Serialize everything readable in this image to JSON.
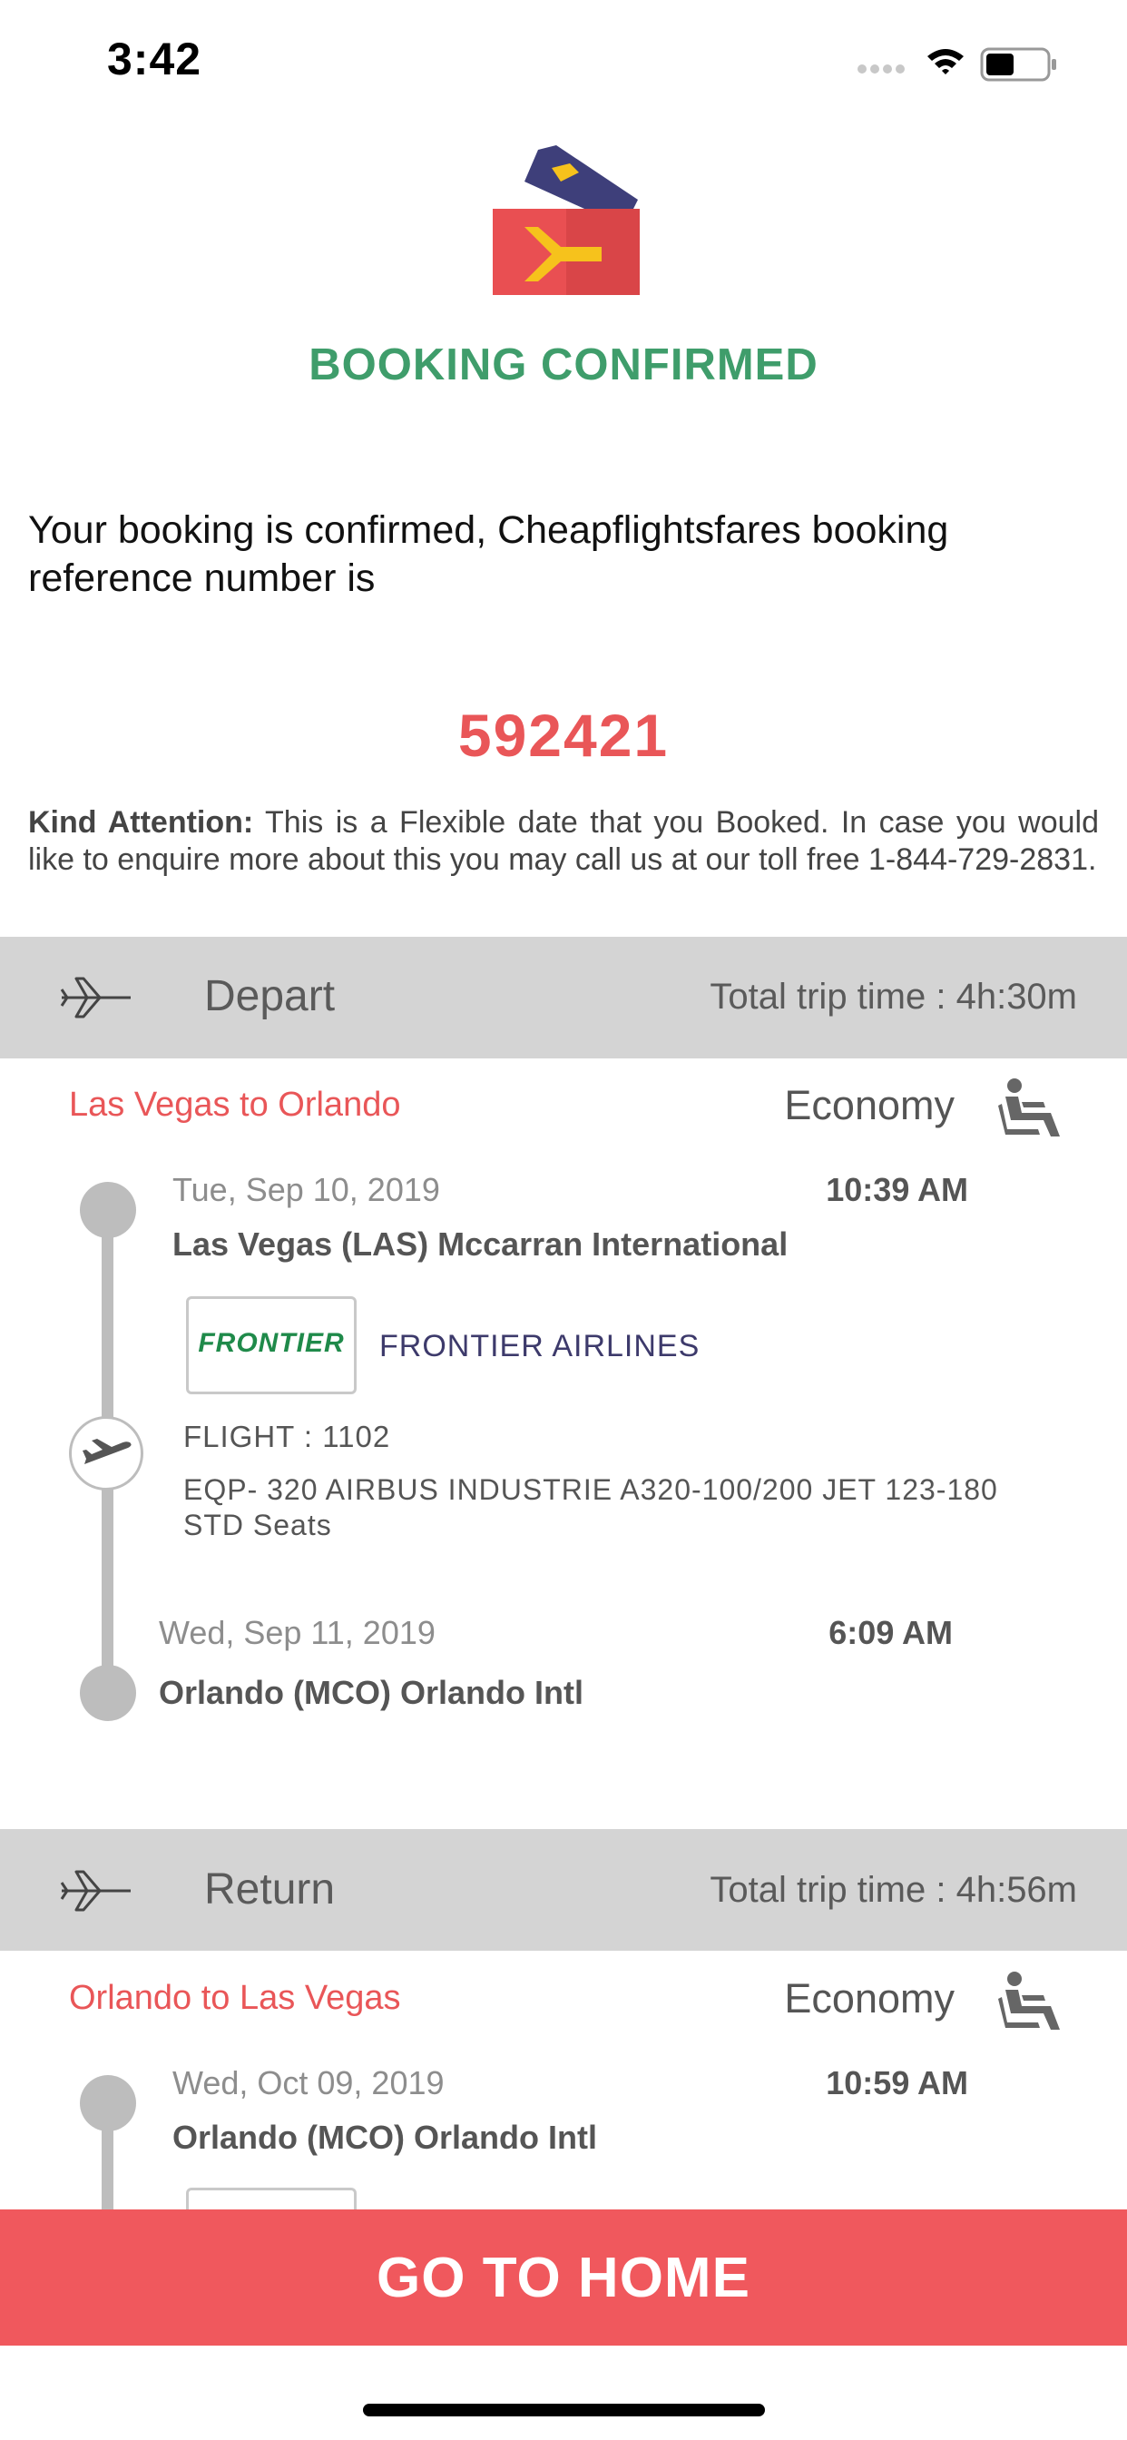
{
  "status_bar": {
    "time": "3:42"
  },
  "header": {
    "title": "BOOKING CONFIRMED",
    "intro": "Your booking is confirmed, Cheapflightsfares booking reference number is",
    "reference_number": "592421",
    "attention_label": "Kind Attention:",
    "attention_text": " This is a Flexible date that you Booked. In case you would like to enquire more about this you may call us at our toll free 1-844-729-2831."
  },
  "depart": {
    "section_title": "Depart",
    "total_trip_time": "Total trip time : 4h:30m",
    "route": "Las Vegas to Orlando",
    "cabin": "Economy",
    "origin_date": "Tue, Sep 10, 2019",
    "origin_time": "10:39 AM",
    "origin_airport": "Las Vegas (LAS) Mccarran International",
    "airline_logo_text": "FRONTIER",
    "airline_name": "FRONTIER AIRLINES",
    "flight": "FLIGHT : 1102",
    "equipment": "EQP- 320 AIRBUS INDUSTRIE A320-100/200 JET 123-180 STD Seats",
    "dest_date": "Wed, Sep 11, 2019",
    "dest_time": "6:09 AM",
    "dest_airport": "Orlando (MCO) Orlando Intl"
  },
  "return": {
    "section_title": "Return",
    "total_trip_time": "Total trip time : 4h:56m",
    "route": "Orlando to Las Vegas",
    "cabin": "Economy",
    "origin_date": "Wed, Oct 09, 2019",
    "origin_time": "10:59 AM",
    "origin_airport": "Orlando (MCO) Orlando Intl"
  },
  "footer": {
    "home_button": "GO TO HOME"
  },
  "colors": {
    "accent_red": "#e95658",
    "confirm_green": "#3f9d6b",
    "section_bg": "#d4d4d4",
    "button_bg": "#f0585d"
  },
  "icons": [
    "wifi-icon",
    "battery-icon",
    "signal-icon",
    "ticket-icon",
    "plane-icon",
    "seat-icon"
  ]
}
